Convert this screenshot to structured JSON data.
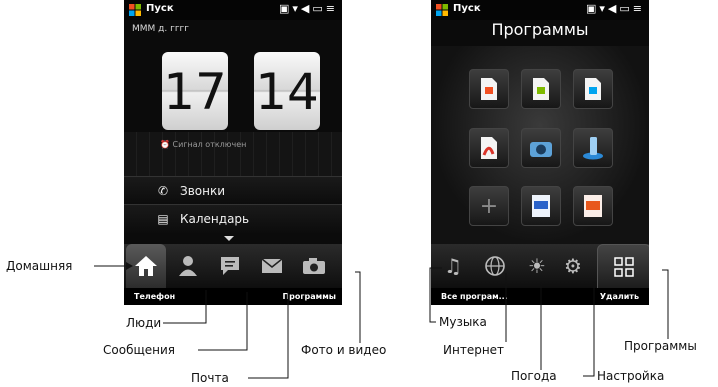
{
  "left_screen": {
    "start_label": "Пуск",
    "date_format": "МММ д. гггг",
    "clock": {
      "hour": "17",
      "minute": "14"
    },
    "alarm_text": "Сигнал отключен",
    "menu_items": [
      {
        "label": "Звонки",
        "icon": "phone-icon"
      },
      {
        "label": "Календарь",
        "icon": "calendar-icon"
      }
    ],
    "tabs": [
      "home-icon",
      "people-icon",
      "messages-icon",
      "mail-icon",
      "photo-icon"
    ],
    "softkeys": {
      "left": "Телефон",
      "right": "Программы"
    }
  },
  "right_screen": {
    "start_label": "Пуск",
    "title": "Программы",
    "tabs": [
      "music-icon",
      "internet-icon",
      "weather-icon",
      "settings-icon",
      "programs-grid-icon"
    ],
    "softkeys": {
      "left": "Все програм...",
      "right": "Удалить"
    }
  },
  "callouts": {
    "home": "Домашняя",
    "people": "Люди",
    "messages": "Сообщения",
    "mail": "Почта",
    "photo_video": "Фото и видео",
    "music": "Музыка",
    "internet": "Интернет",
    "weather": "Погода",
    "settings": "Настройка",
    "programs": "Программы"
  },
  "colors": {
    "screen_bg": "#0b0b0b",
    "callout_line": "#111111",
    "file_icon_red": "#d9352a",
    "ppt_orange": "#e8581c",
    "word_blue": "#2a62c9"
  }
}
